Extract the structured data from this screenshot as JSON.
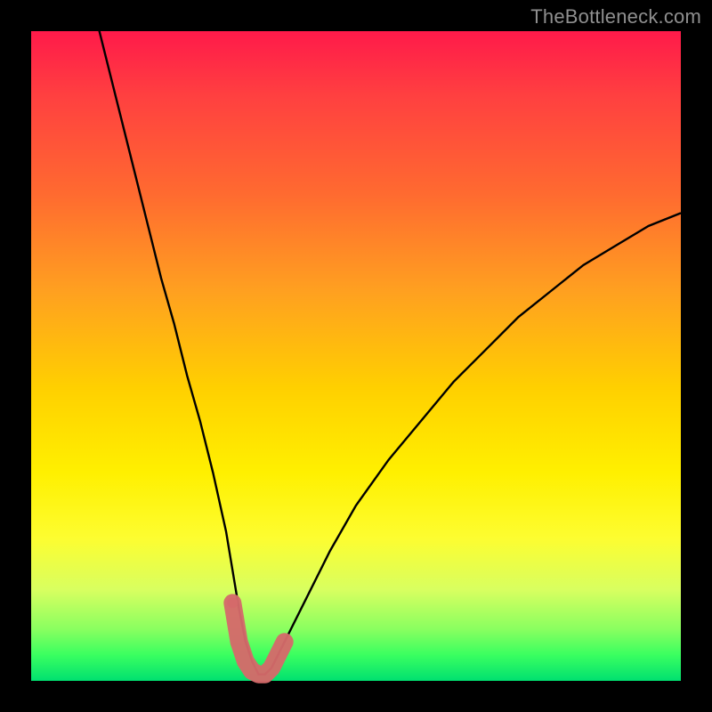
{
  "watermark": "TheBottleneck.com",
  "colors": {
    "background": "#000000",
    "curve": "#000000",
    "highlight": "#d46a6a"
  },
  "chart_data": {
    "type": "line",
    "title": "",
    "xlabel": "",
    "ylabel": "",
    "xlim": [
      0,
      100
    ],
    "ylim": [
      0,
      100
    ],
    "grid": false,
    "series": [
      {
        "name": "bottleneck-curve",
        "x": [
          10,
          12,
          14,
          16,
          18,
          20,
          22,
          24,
          26,
          28,
          30,
          31,
          32,
          33,
          34,
          35,
          36,
          37,
          38,
          40,
          43,
          46,
          50,
          55,
          60,
          65,
          70,
          75,
          80,
          85,
          90,
          95,
          100
        ],
        "y": [
          102,
          94,
          86,
          78,
          70,
          62,
          55,
          47,
          40,
          32,
          23,
          17,
          11,
          6,
          3,
          1,
          1,
          2,
          4,
          8,
          14,
          20,
          27,
          34,
          40,
          46,
          51,
          56,
          60,
          64,
          67,
          70,
          72
        ]
      }
    ],
    "highlight": {
      "name": "trough-marker",
      "points": [
        {
          "x": 31.0,
          "y": 12,
          "r": 6
        },
        {
          "x": 32.0,
          "y": 6,
          "r": 9
        },
        {
          "x": 33.0,
          "y": 3,
          "r": 10
        },
        {
          "x": 34.0,
          "y": 1.5,
          "r": 10
        },
        {
          "x": 35.0,
          "y": 1,
          "r": 10
        },
        {
          "x": 36.0,
          "y": 1,
          "r": 10
        },
        {
          "x": 37.0,
          "y": 2,
          "r": 10
        },
        {
          "x": 38.0,
          "y": 4,
          "r": 10
        },
        {
          "x": 39.0,
          "y": 6,
          "r": 9
        }
      ]
    }
  }
}
